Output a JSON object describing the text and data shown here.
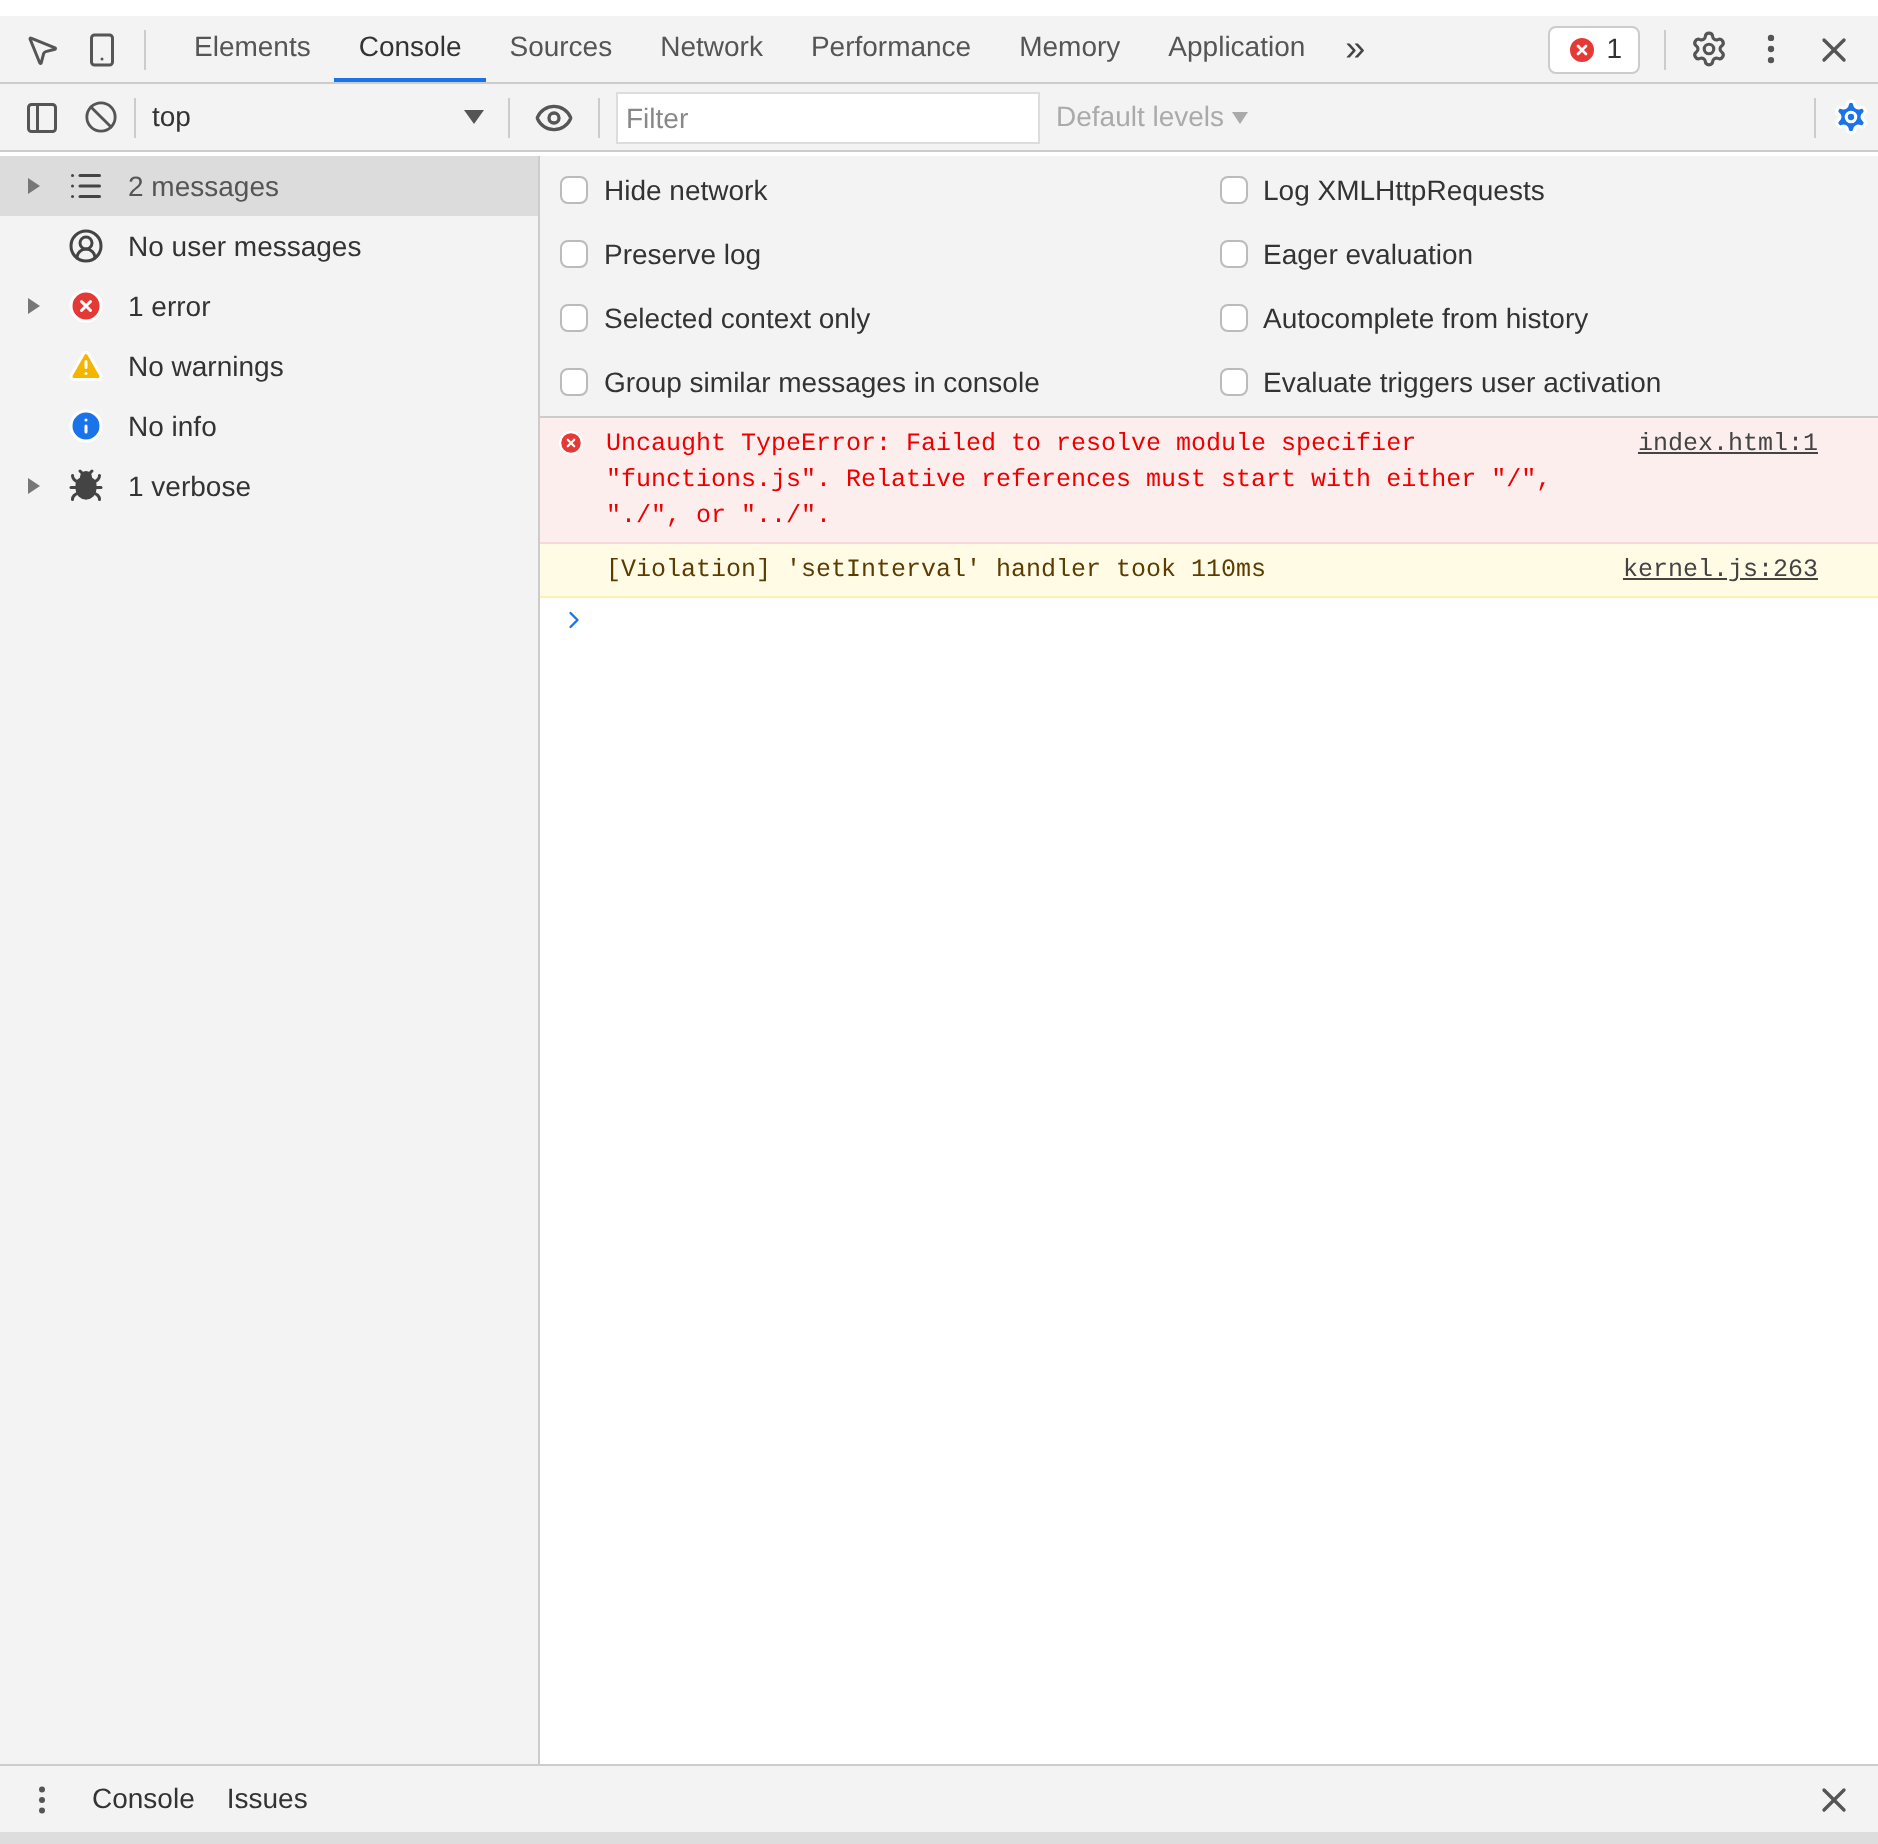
{
  "tabs": [
    {
      "label": "Elements",
      "selected": false
    },
    {
      "label": "Console",
      "selected": true
    },
    {
      "label": "Sources",
      "selected": false
    },
    {
      "label": "Network",
      "selected": false
    },
    {
      "label": "Performance",
      "selected": false
    },
    {
      "label": "Memory",
      "selected": false
    },
    {
      "label": "Application",
      "selected": false
    }
  ],
  "more_tabs": "»",
  "error_count": "1",
  "toolbar": {
    "context": "top",
    "filter_placeholder": "Filter",
    "levels": "Default levels"
  },
  "sidebar": {
    "items": [
      {
        "label": "2 messages",
        "kind": "list",
        "expandable": true,
        "selected": true
      },
      {
        "label": "No user messages",
        "kind": "user",
        "expandable": false,
        "selected": false
      },
      {
        "label": "1 error",
        "kind": "error",
        "expandable": true,
        "selected": false
      },
      {
        "label": "No warnings",
        "kind": "warning",
        "expandable": false,
        "selected": false
      },
      {
        "label": "No info",
        "kind": "info",
        "expandable": false,
        "selected": false
      },
      {
        "label": "1 verbose",
        "kind": "verbose",
        "expandable": true,
        "selected": false
      }
    ]
  },
  "settings": {
    "left": [
      {
        "label": "Hide network",
        "checked": false
      },
      {
        "label": "Preserve log",
        "checked": false
      },
      {
        "label": "Selected context only",
        "checked": false
      },
      {
        "label": "Group similar messages in console",
        "checked": false
      }
    ],
    "right": [
      {
        "label": "Log XMLHttpRequests",
        "checked": false
      },
      {
        "label": "Eager evaluation",
        "checked": false
      },
      {
        "label": "Autocomplete from history",
        "checked": false
      },
      {
        "label": "Evaluate triggers user activation",
        "checked": false
      }
    ]
  },
  "messages": [
    {
      "kind": "error",
      "text": "Uncaught TypeError: Failed to resolve module specifier \"functions.js\". Relative references must start with either \"/\", \"./\", or \"../\".",
      "source": "index.html:1"
    },
    {
      "kind": "violation",
      "text": "[Violation] 'setInterval' handler took 110ms",
      "source": "kernel.js:263"
    }
  ],
  "drawer": {
    "tabs": [
      {
        "label": "Console"
      },
      {
        "label": "Issues"
      }
    ]
  }
}
